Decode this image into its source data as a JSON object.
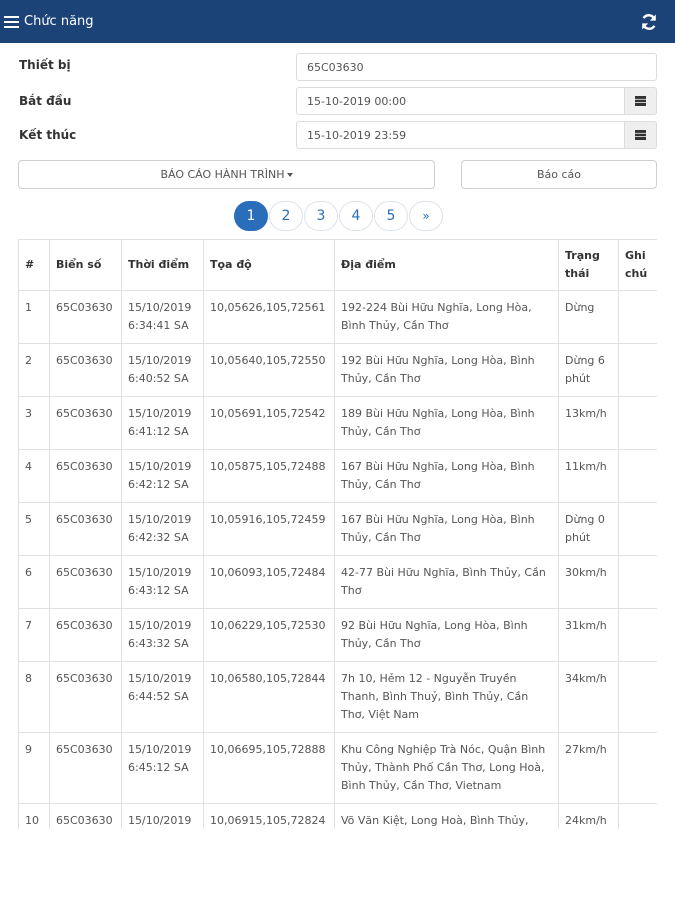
{
  "header": {
    "menu_label": "Chức năng"
  },
  "form": {
    "device_label": "Thiết bị",
    "device_value": "65C03630",
    "start_label": "Bắt đầu",
    "start_value": "15-10-2019 00:00",
    "end_label": "Kết thúc",
    "end_value": "15-10-2019 23:59"
  },
  "buttons": {
    "report_type": "BÁO CÁO HÀNH TRÌNH",
    "report": "Báo cáo"
  },
  "pagination": {
    "pages": [
      "1",
      "2",
      "3",
      "4",
      "5"
    ],
    "next": "»",
    "active": "1"
  },
  "table": {
    "headers": [
      "#",
      "Biển số",
      "Thời điểm",
      "Tọa độ",
      "Địa điểm",
      "Trạng thái",
      "Ghi chú"
    ],
    "rows": [
      {
        "no": "1",
        "plate": "65C03630",
        "time": "15/10/2019 6:34:41 SA",
        "coord": "10,05626,105,72561",
        "place": "192-224 Bùi Hữu Nghĩa, Long Hòa, Bình Thủy, Cần Thơ",
        "status": "Dừng",
        "note": ""
      },
      {
        "no": "2",
        "plate": "65C03630",
        "time": "15/10/2019 6:40:52 SA",
        "coord": "10,05640,105,72550",
        "place": "192 Bùi Hữu Nghĩa, Long Hòa, Bình Thủy, Cần Thơ",
        "status": "Dừng 6 phút",
        "note": ""
      },
      {
        "no": "3",
        "plate": "65C03630",
        "time": "15/10/2019 6:41:12 SA",
        "coord": "10,05691,105,72542",
        "place": "189 Bùi Hữu Nghĩa, Long Hòa, Bình Thủy, Cần Thơ",
        "status": "13km/h",
        "note": ""
      },
      {
        "no": "4",
        "plate": "65C03630",
        "time": "15/10/2019 6:42:12 SA",
        "coord": "10,05875,105,72488",
        "place": "167 Bùi Hữu Nghĩa, Long Hòa, Bình Thủy, Cần Thơ",
        "status": "11km/h",
        "note": ""
      },
      {
        "no": "5",
        "plate": "65C03630",
        "time": "15/10/2019 6:42:32 SA",
        "coord": "10,05916,105,72459",
        "place": "167 Bùi Hữu Nghĩa, Long Hòa, Bình Thủy, Cần Thơ",
        "status": "Dừng 0 phút",
        "note": ""
      },
      {
        "no": "6",
        "plate": "65C03630",
        "time": "15/10/2019 6:43:12 SA",
        "coord": "10,06093,105,72484",
        "place": "42-77 Bùi Hữu Nghĩa, Bình Thủy, Cần Thơ",
        "status": "30km/h",
        "note": ""
      },
      {
        "no": "7",
        "plate": "65C03630",
        "time": "15/10/2019 6:43:32 SA",
        "coord": "10,06229,105,72530",
        "place": "92 Bùi Hữu Nghĩa, Long Hòa, Bình Thủy, Cần Thơ",
        "status": "31km/h",
        "note": ""
      },
      {
        "no": "8",
        "plate": "65C03630",
        "time": "15/10/2019 6:44:52 SA",
        "coord": "10,06580,105,72844",
        "place": "7h 10, Hẻm 12 - Nguyễn Truyền Thanh, Bình Thuỷ, Bình Thủy, Cần Thơ, Việt Nam",
        "status": "34km/h",
        "note": ""
      },
      {
        "no": "9",
        "plate": "65C03630",
        "time": "15/10/2019 6:45:12 SA",
        "coord": "10,06695,105,72888",
        "place": "Khu Công Nghiệp Trà Nóc, Quận Bình Thủy, Thành Phố Cần Thơ, Long Hoà, Bình Thủy, Cần Thơ, Vietnam",
        "status": "27km/h",
        "note": ""
      },
      {
        "no": "10",
        "plate": "65C03630",
        "time": "15/10/2019",
        "coord": "10,06915,105,72824",
        "place": "Võ Văn Kiệt, Long Hoà, Bình Thủy,",
        "status": "24km/h",
        "note": ""
      }
    ]
  }
}
